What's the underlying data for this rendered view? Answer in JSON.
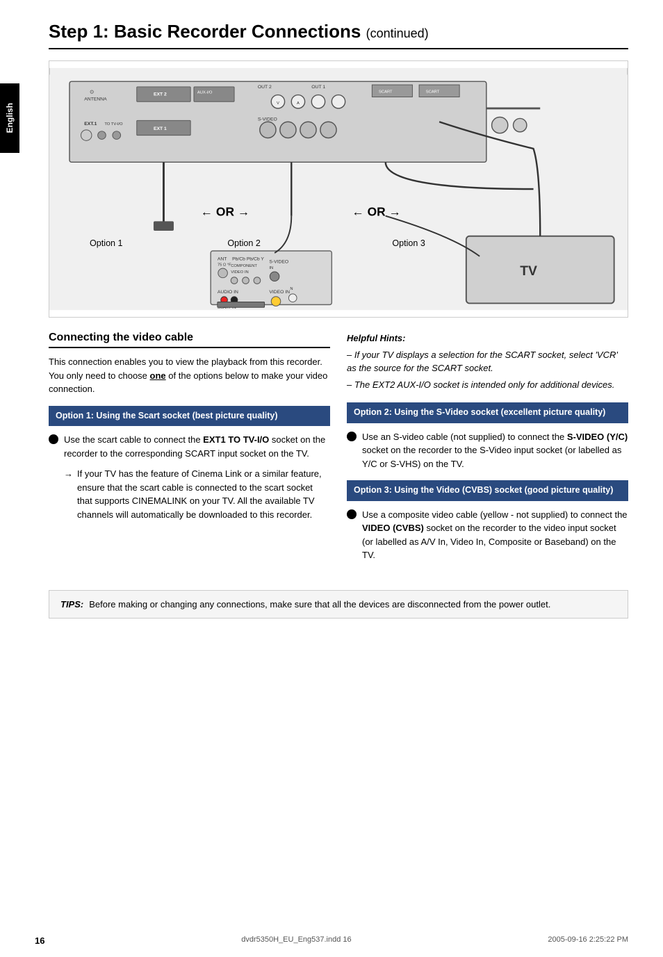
{
  "header": {
    "title": "Step 1: Basic Recorder Connections",
    "continued": "(continued)"
  },
  "side_tab": {
    "label": "English"
  },
  "section_heading": "Connecting the video cable",
  "intro_text": "This connection enables you to view the playback from this recorder. You only need to choose ",
  "intro_bold": "one",
  "intro_text2": " of the options below to make your video connection.",
  "option1": {
    "title": "Option 1: Using the Scart socket (best picture quality)",
    "bullet": "Use the scart cable to connect the ",
    "bullet_bold": "EXT1 TO TV-I/O",
    "bullet2": " socket on the recorder to the corresponding SCART input socket on the TV.",
    "arrow_text": "If your TV has the feature of Cinema Link or a similar feature, ensure that the scart cable is connected to the scart socket that supports CINEMALINK on your TV. All the available TV channels will automatically be downloaded to this recorder."
  },
  "helpful_hints": {
    "title": "Helpful Hints:",
    "hint1": "– If your TV displays a selection for the SCART socket, select 'VCR' as the source for the SCART socket.",
    "hint2": "– The EXT2 AUX-I/O socket is intended only for additional devices."
  },
  "option2": {
    "title": "Option 2: Using the S-Video socket (excellent picture quality)",
    "bullet": "Use an S-video cable (not supplied) to connect the ",
    "bullet_bold": "S-VIDEO (Y/C)",
    "bullet2": " socket on the recorder to the S-Video input socket (or labelled as Y/C or S-VHS) on the TV."
  },
  "option3": {
    "title": "Option 3: Using the Video (CVBS) socket (good picture quality)",
    "bullet": "Use a composite video cable (yellow - not supplied) to connect the ",
    "bullet_bold": "VIDEO (CVBS)",
    "bullet2": " socket on the recorder to the video input socket (or labelled as A/V In, Video In, Composite or Baseband) on the TV."
  },
  "tips": {
    "label": "TIPS:",
    "text": "Before making or changing any connections, make sure that all the devices are disconnected from the power outlet."
  },
  "footer": {
    "page_number": "16",
    "filename": "dvdr5350H_EU_Eng537.indd   16",
    "date": "2005-09-16   2:25:22 PM"
  },
  "diagram": {
    "option1_label": "Option 1",
    "option2_label": "Option 2",
    "option3_label": "Option 3",
    "or1": "OR",
    "or2": "OR",
    "tv_label": "TV"
  }
}
